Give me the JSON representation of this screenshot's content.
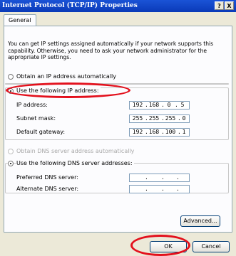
{
  "window": {
    "title": "Internet Protocol (TCP/IP) Properties",
    "help_button": "?",
    "close_button": "X"
  },
  "tabs": [
    {
      "label": "General"
    }
  ],
  "intro_text": "You can get IP settings assigned automatically if your network supports this capability. Otherwise, you need to ask your network administrator for the appropriate IP settings.",
  "ip_mode": {
    "auto_label": "Obtain an IP address automatically",
    "manual_label": "Use the following IP address:",
    "selected": "manual"
  },
  "ip_fields": {
    "ip_address": {
      "label": "IP address:",
      "value": [
        "192",
        "168",
        "0",
        "5"
      ]
    },
    "subnet_mask": {
      "label": "Subnet mask:",
      "value": [
        "255",
        "255",
        "255",
        "0"
      ]
    },
    "default_gateway": {
      "label": "Default gateway:",
      "value": [
        "192",
        "168",
        "100",
        "1"
      ]
    }
  },
  "dns_mode": {
    "auto_label": "Obtain DNS server address automatically",
    "manual_label": "Use the following DNS server addresses:",
    "selected": "manual"
  },
  "dns_fields": {
    "preferred": {
      "label": "Preferred DNS server:",
      "value": [
        ".",
        ".",
        "."
      ]
    },
    "alternate": {
      "label": "Alternate DNS server:",
      "value": [
        ".",
        ".",
        "."
      ]
    }
  },
  "buttons": {
    "advanced": "Advanced...",
    "ok": "OK",
    "cancel": "Cancel"
  },
  "highlight_color": "#e3101c"
}
